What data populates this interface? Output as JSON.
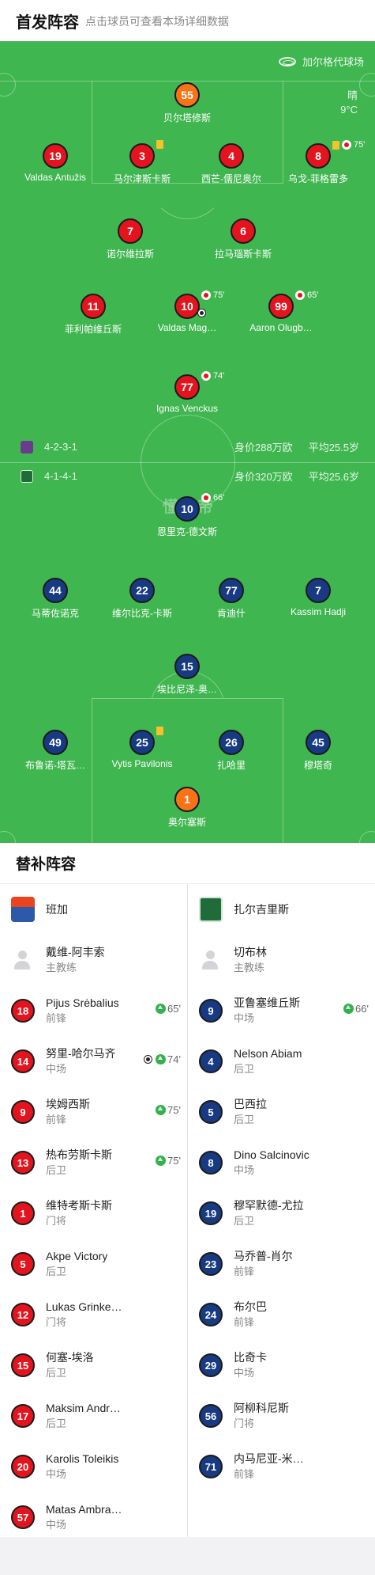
{
  "lineup": {
    "title": "首发阵容",
    "subtitle": "点击球员可查看本场详细数据",
    "venue": "加尔格代球场",
    "weather": "晴",
    "temperature": "9°C",
    "watermark": "懂球帝",
    "home": {
      "formation": "4-2-3-1",
      "value": "身价288万欧",
      "avg_age": "平均25.5岁",
      "color": "#e3141e",
      "players": [
        {
          "id": "gk",
          "number": "55",
          "name": "贝尔塔修斯",
          "keeper": true
        },
        {
          "id": "d1",
          "number": "19",
          "name": "Valdas Antužis"
        },
        {
          "id": "d2",
          "number": "3",
          "name": "马尔津斯卡斯",
          "yellow": true
        },
        {
          "id": "d3",
          "number": "4",
          "name": "西芒-儒尼奥尔"
        },
        {
          "id": "d4",
          "number": "8",
          "name": "乌戈-菲格雷多",
          "yellow": true,
          "sub_off": "75'"
        },
        {
          "id": "m1",
          "number": "7",
          "name": "诺尔维拉斯"
        },
        {
          "id": "m2",
          "number": "6",
          "name": "拉马瑙斯卡斯"
        },
        {
          "id": "a1",
          "number": "11",
          "name": "菲利帕维丘斯"
        },
        {
          "id": "a2",
          "number": "10",
          "name": "Valdas Mag…",
          "sub_off": "75'",
          "goal": true
        },
        {
          "id": "a3",
          "number": "99",
          "name": "Aaron Olugb…",
          "sub_off": "65'"
        },
        {
          "id": "st",
          "number": "77",
          "name": "Ignas Venckus",
          "sub_off": "74'"
        }
      ]
    },
    "away": {
      "formation": "4-1-4-1",
      "value": "身价320万欧",
      "avg_age": "平均25.6岁",
      "color": "#173a82",
      "players": [
        {
          "id": "st",
          "number": "10",
          "name": "恩里克-德文斯",
          "sub_off": "66'"
        },
        {
          "id": "m1",
          "number": "44",
          "name": "马蒂佐诺克"
        },
        {
          "id": "m2",
          "number": "22",
          "name": "维尔比克-卡斯"
        },
        {
          "id": "m3",
          "number": "77",
          "name": "肯迪什"
        },
        {
          "id": "m4",
          "number": "7",
          "name": "Kassim Hadji"
        },
        {
          "id": "dm",
          "number": "15",
          "name": "埃比尼泽-奥…"
        },
        {
          "id": "d1",
          "number": "49",
          "name": "布鲁诺-塔瓦…"
        },
        {
          "id": "d2",
          "number": "25",
          "name": "Vytis Pavilonis",
          "yellow": true
        },
        {
          "id": "d3",
          "number": "26",
          "name": "扎哈里"
        },
        {
          "id": "d4",
          "number": "45",
          "name": "穆塔奇"
        },
        {
          "id": "gk",
          "number": "1",
          "name": "奥尔塞斯",
          "keeper": true
        }
      ]
    }
  },
  "subs": {
    "title": "替补阵容",
    "home": {
      "team": "班加",
      "coach": {
        "name": "戴维-阿丰索",
        "role": "主教练"
      },
      "players": [
        {
          "number": "18",
          "name": "Pijus Srėbalius",
          "pos": "前锋",
          "sub_on": "65'"
        },
        {
          "number": "14",
          "name": "努里-哈尔马齐",
          "pos": "中场",
          "sub_on": "74'",
          "goal": true
        },
        {
          "number": "9",
          "name": "埃姆西斯",
          "pos": "前锋",
          "sub_on": "75'"
        },
        {
          "number": "13",
          "name": "热布劳斯卡斯",
          "pos": "后卫",
          "sub_on": "75'"
        },
        {
          "number": "1",
          "name": "维特考斯卡斯",
          "pos": "门将"
        },
        {
          "number": "5",
          "name": "Akpe Victory",
          "pos": "后卫"
        },
        {
          "number": "12",
          "name": "Lukas Grinke…",
          "pos": "门将"
        },
        {
          "number": "15",
          "name": "何塞-埃洛",
          "pos": "后卫"
        },
        {
          "number": "17",
          "name": "Maksim Andr…",
          "pos": "后卫"
        },
        {
          "number": "20",
          "name": "Karolis Toleikis",
          "pos": "中场"
        },
        {
          "number": "57",
          "name": "Matas Ambra…",
          "pos": "中场"
        }
      ]
    },
    "away": {
      "team": "扎尔吉里斯",
      "coach": {
        "name": "切布林",
        "role": "主教练"
      },
      "players": [
        {
          "number": "9",
          "name": "亚鲁塞维丘斯",
          "pos": "中场",
          "sub_on": "66'"
        },
        {
          "number": "4",
          "name": "Nelson Abiam",
          "pos": "后卫"
        },
        {
          "number": "5",
          "name": "巴西拉",
          "pos": "后卫"
        },
        {
          "number": "8",
          "name": "Dino Salcinovic",
          "pos": "中场"
        },
        {
          "number": "19",
          "name": "穆罕默德-尤拉",
          "pos": "后卫"
        },
        {
          "number": "23",
          "name": "马乔普-肖尔",
          "pos": "前锋"
        },
        {
          "number": "24",
          "name": "布尔巴",
          "pos": "前锋"
        },
        {
          "number": "29",
          "name": "比奇卡",
          "pos": "中场"
        },
        {
          "number": "56",
          "name": "阿柳科尼斯",
          "pos": "门将"
        },
        {
          "number": "71",
          "name": "内马尼亚-米…",
          "pos": "前锋"
        }
      ]
    }
  }
}
